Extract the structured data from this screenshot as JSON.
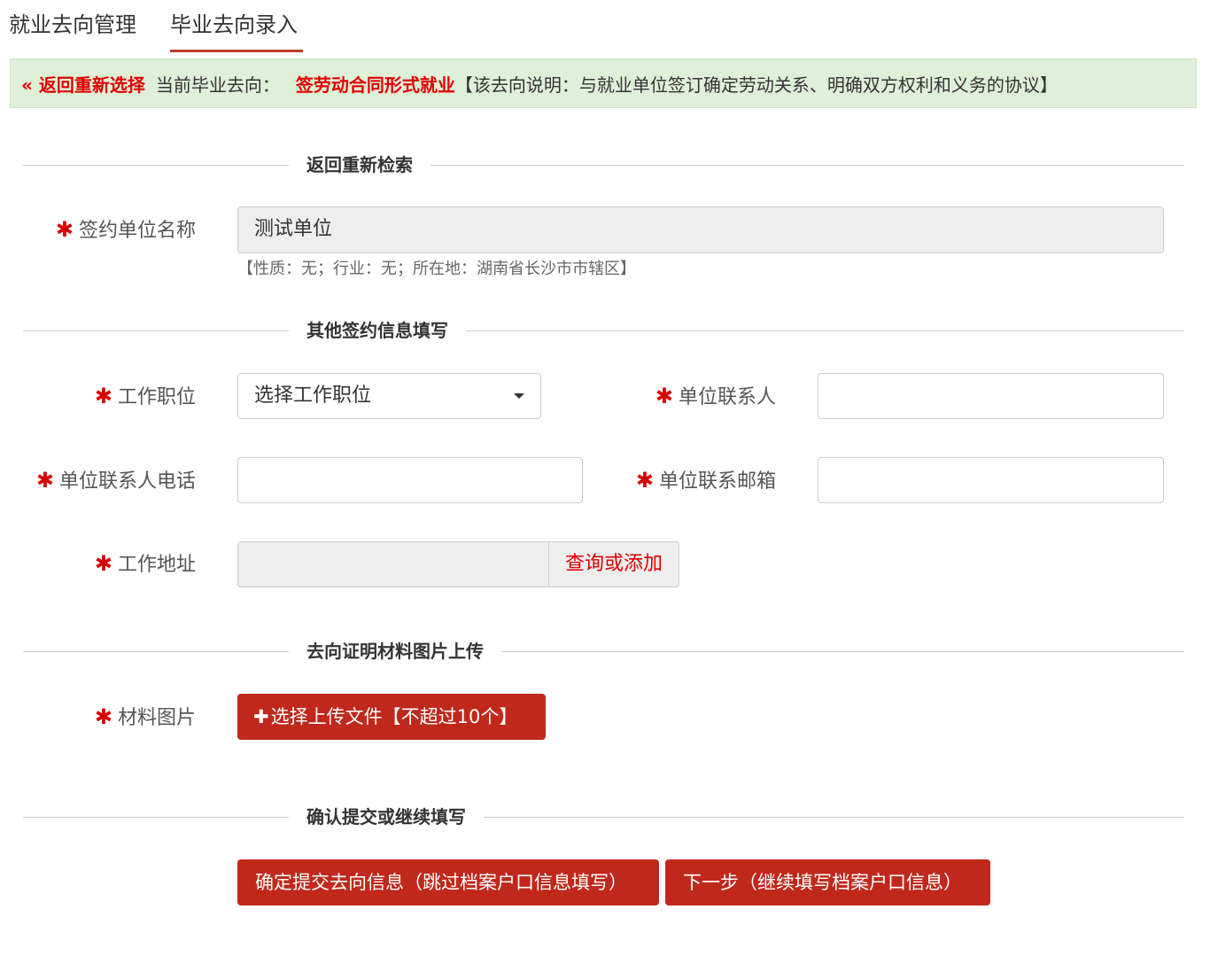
{
  "tabs": [
    {
      "label": "就业去向管理"
    },
    {
      "label": "毕业去向录入"
    }
  ],
  "notice": {
    "back_label": "« 返回重新选择",
    "current_label": "当前毕业去向：",
    "current_value": "签劳动合同形式就业",
    "description": "【该去向说明：与就业单位签订确定劳动关系、明确双方权利和义务的协议】"
  },
  "sections": {
    "search": "返回重新检索",
    "other": "其他签约信息填写",
    "upload": "去向证明材料图片上传",
    "confirm": "确认提交或继续填写"
  },
  "form": {
    "required_mark": "✱",
    "unit_name": {
      "label": "签约单位名称",
      "value": "测试单位",
      "hint": "【性质：无；行业：无；所在地：湖南省长沙市市辖区】"
    },
    "position": {
      "label": "工作职位",
      "selected": "选择工作职位"
    },
    "contact": {
      "label": "单位联系人",
      "value": ""
    },
    "contact_phone": {
      "label": "单位联系人电话",
      "value": ""
    },
    "contact_email": {
      "label": "单位联系邮箱",
      "value": ""
    },
    "work_address": {
      "label": "工作地址",
      "value": "",
      "button": "查询或添加"
    },
    "material": {
      "label": "材料图片",
      "button": "选择上传文件【不超过10个】",
      "icon": "plus-icon"
    }
  },
  "actions": {
    "submit": "确定提交去向信息（跳过档案户口信息填写）",
    "next": "下一步（继续填写档案户口信息）"
  },
  "colors": {
    "accent": "#c0281c",
    "alert_red": "#e00000",
    "notice_bg": "#dff0d8"
  }
}
